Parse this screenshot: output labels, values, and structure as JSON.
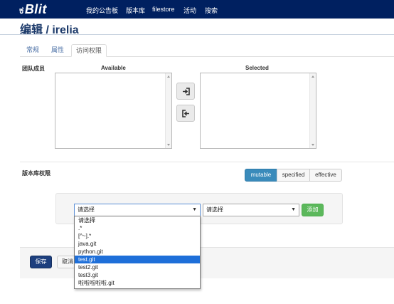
{
  "nav": {
    "logo": "Blit",
    "items": [
      "我的公告板",
      "版本库",
      "filestore",
      "活动",
      "搜索"
    ]
  },
  "page": {
    "title": "编辑 / irelia"
  },
  "tabs": [
    "常规",
    "属性",
    "访问权限"
  ],
  "team_members": {
    "label": "团队成员",
    "available_label": "Available",
    "selected_label": "Selected"
  },
  "repo_permissions": {
    "label": "版本库权限",
    "modes": [
      "mutable",
      "specified",
      "effective"
    ],
    "active_mode": "mutable"
  },
  "add_permission": {
    "repo_select_value": "请选择",
    "permission_select_value": "请选择",
    "add_label": "添加"
  },
  "dropdown": {
    "options": [
      "请选择",
      ".*",
      "[^~].*",
      "java.git",
      "python.git",
      "test.git",
      "test2.git",
      "test3.git",
      "啦啦啦啦啦.git"
    ],
    "highlighted": "test.git"
  },
  "footer": {
    "save_label": "保存",
    "cancel_label": "取消"
  },
  "colors": {
    "navbar": "#002060",
    "accent": "#3a8bbb",
    "save": "#1d3f7e",
    "add": "#5cb85c"
  },
  "icons": {
    "move_right": "sign-in-icon",
    "move_left": "sign-out-icon",
    "logo": "gitblit-logo-icon"
  }
}
